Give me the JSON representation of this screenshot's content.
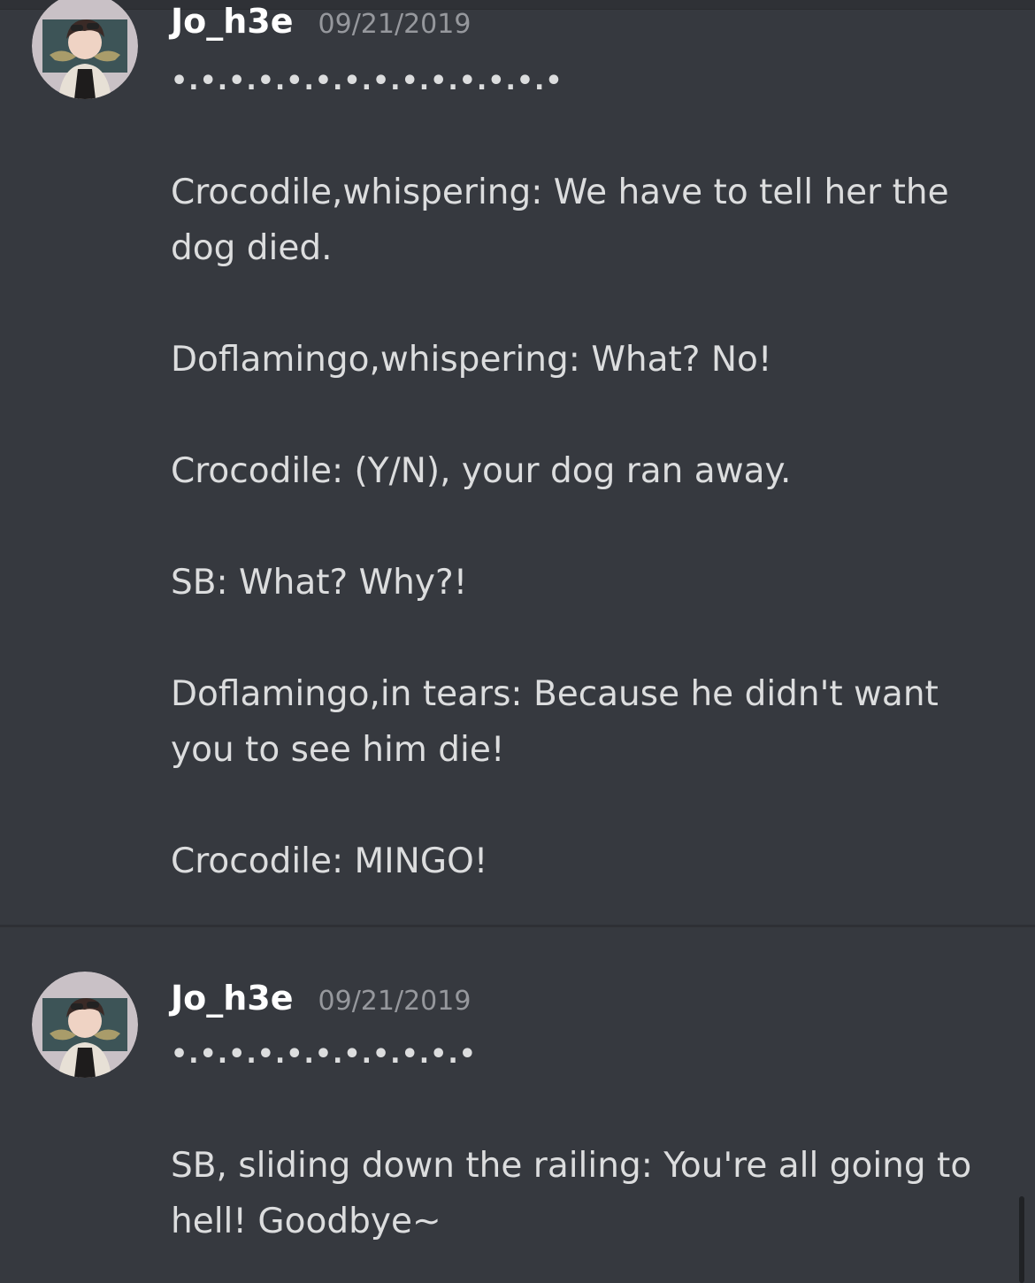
{
  "messages": [
    {
      "username": "Jo_h3e",
      "timestamp": "09/21/2019",
      "lines": [
        "•.•.•.•.•.•.•.•.•.•.•.•.•.•",
        "",
        "Crocodile,whispering: We have to tell her the",
        "dog died.",
        "",
        "Doflamingo,whispering: What? No!",
        "",
        "Crocodile: (Y/N), your dog ran away.",
        "",
        "SB: What? Why?!",
        "",
        "Doflamingo,in tears: Because he didn't want",
        "you to see him die!",
        "",
        "Crocodile: MINGO!"
      ]
    },
    {
      "username": "Jo_h3e",
      "timestamp": "09/21/2019",
      "lines": [
        "•.•.•.•.•.•.•.•.•.•.•",
        "",
        "SB, sliding down the railing: You're all going to",
        "hell! Goodbye~"
      ]
    }
  ],
  "avatar_icon": "user-avatar-icon",
  "colors": {
    "background": "#36393f",
    "username": "#ffffff",
    "timestamp": "#96989d",
    "text": "#dcddde"
  }
}
